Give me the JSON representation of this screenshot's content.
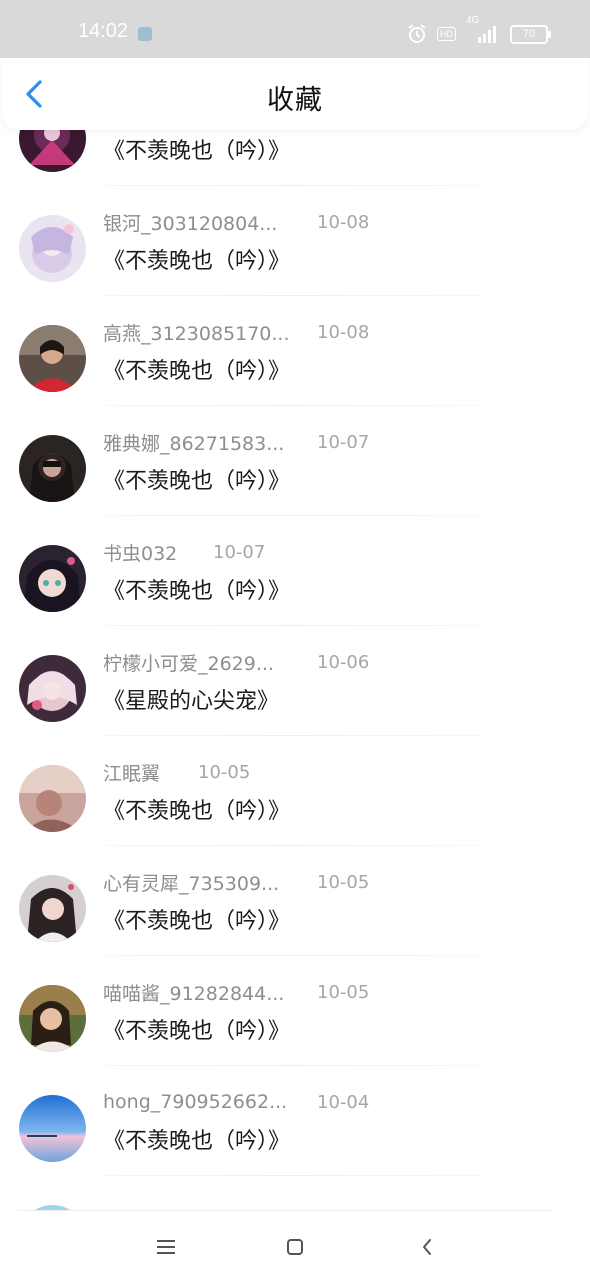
{
  "status_bar": {
    "time": "14:02",
    "network": "4G",
    "hd": "HD",
    "battery": "70"
  },
  "header": {
    "title": "收藏",
    "accent_color": "#2a8ef0"
  },
  "items": [
    {
      "author": "",
      "date": "",
      "book": "《不羡晚也（吟）》",
      "avatar": "anime-dark-avatar"
    },
    {
      "author": "银河_303120804...",
      "date": "10-08",
      "book": "《不羡晚也（吟）》",
      "avatar": "anime-pastel-avatar"
    },
    {
      "author": "高燕_3123085170...",
      "date": "10-08",
      "book": "《不羡晚也（吟）》",
      "avatar": "woman-red-avatar"
    },
    {
      "author": "雅典娜_86271583...",
      "date": "10-07",
      "book": "《不羡晚也（吟）》",
      "avatar": "dark-portrait-avatar"
    },
    {
      "author": "书虫032",
      "date": "10-07",
      "book": "《不羡晚也（吟）》",
      "avatar": "anime-girl-avatar"
    },
    {
      "author": "柠檬小可爱_2629...",
      "date": "10-06",
      "book": "《星殿的心尖宠》",
      "avatar": "anime-pink-avatar"
    },
    {
      "author": "江眠翼",
      "date": "10-05",
      "book": "《不羡晚也（吟）》",
      "avatar": "warm-portrait-avatar"
    },
    {
      "author": "心有灵犀_735309...",
      "date": "10-05",
      "book": "《不羡晚也（吟）》",
      "avatar": "girl-portrait-avatar"
    },
    {
      "author": "喵喵酱_91282844...",
      "date": "10-05",
      "book": "《不羡晚也（吟）》",
      "avatar": "outdoor-portrait-avatar"
    },
    {
      "author": "hong_790952662...",
      "date": "10-04",
      "book": "《不羡晚也（吟）》",
      "avatar": "sky-sea-avatar"
    }
  ]
}
